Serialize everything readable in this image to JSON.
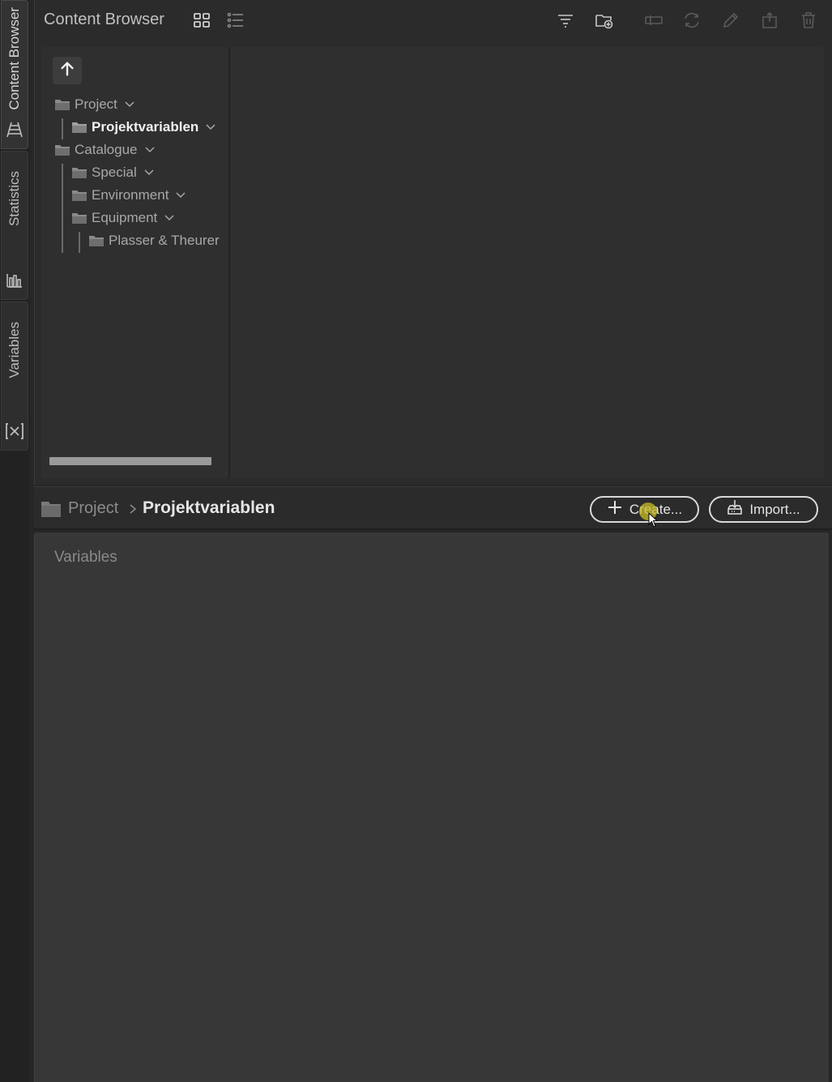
{
  "side_tabs": [
    {
      "label": "Content Browser",
      "icon": "rail-track-icon",
      "active": true
    },
    {
      "label": "Statistics",
      "icon": "statistics-chart-icon",
      "active": false
    },
    {
      "label": "Variables",
      "icon": "variable-x-icon",
      "active": false
    }
  ],
  "content_browser": {
    "title": "Content Browser",
    "toolbar_icons": [
      "grid-view-icon",
      "list-view-icon",
      "filter-icon",
      "new-folder-icon",
      "rename-icon",
      "refresh-icon",
      "edit-icon",
      "export-icon",
      "delete-icon"
    ]
  },
  "tree": {
    "items": [
      {
        "label": "Project",
        "level": 0,
        "expanded": true,
        "selected": false
      },
      {
        "label": "Projektvariablen",
        "level": 1,
        "expanded": true,
        "selected": true
      },
      {
        "label": "Catalogue",
        "level": 0,
        "expanded": true,
        "selected": false
      },
      {
        "label": "Special",
        "level": 1,
        "expanded": true,
        "selected": false
      },
      {
        "label": "Environment",
        "level": 1,
        "expanded": true,
        "selected": false
      },
      {
        "label": "Equipment",
        "level": 1,
        "expanded": true,
        "selected": false
      },
      {
        "label": "Plasser & Theurer",
        "level": 2,
        "expanded": false,
        "selected": false
      }
    ]
  },
  "breadcrumb": {
    "parent": "Project",
    "current": "Projektvariablen"
  },
  "actions": {
    "create_label": "Create...",
    "import_label": "Import..."
  },
  "variables_panel": {
    "title": "Variables"
  },
  "colors": {
    "background": "#262626",
    "panel": "#2b2b2b",
    "variables_panel": "#373737",
    "cursor_highlight": "#c8be28"
  }
}
